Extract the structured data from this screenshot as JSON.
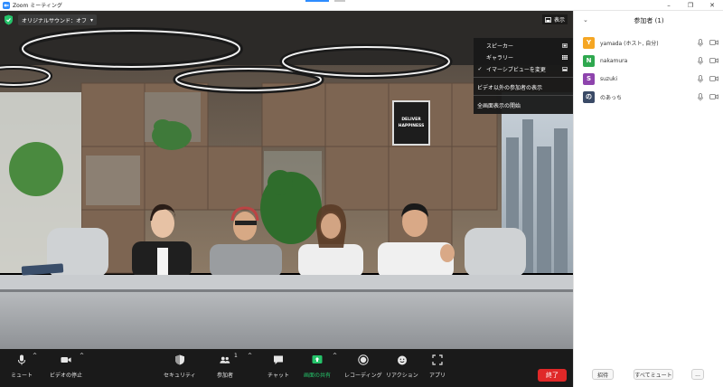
{
  "window": {
    "title": "Zoom ミーティング",
    "controls": {
      "minimize": "–",
      "restore": "❐",
      "close": "✕"
    }
  },
  "meeting": {
    "audio_label": "オリジナルサウンド：オフ",
    "audio_chevron": "▾",
    "view_button_label": "表示",
    "view_menu": {
      "items": [
        {
          "label": "スピーカー",
          "checked": false,
          "icon": "speaker-view-icon"
        },
        {
          "label": "ギャラリー",
          "checked": false,
          "icon": "gallery-view-icon"
        },
        {
          "label": "イマーシブビューを変更",
          "checked": true,
          "icon": "immersive-view-icon"
        },
        {
          "label": "ビデオ以外の参加者の表示",
          "checked": false
        },
        {
          "label": "全画面表示の開始",
          "checked": false
        }
      ],
      "check_mark": "✓"
    },
    "poster_text": [
      "DELIVER",
      "HAPPINESS"
    ]
  },
  "toolbar": {
    "items": [
      {
        "id": "mute",
        "label": "ミュート",
        "icon": "microphone-icon",
        "has_caret": true
      },
      {
        "id": "video",
        "label": "ビデオの停止",
        "icon": "video-camera-icon",
        "has_caret": true
      },
      {
        "id": "security",
        "label": "セキュリティ",
        "icon": "shield-icon",
        "has_caret": false
      },
      {
        "id": "participants",
        "label": "参加者",
        "icon": "participants-icon",
        "has_caret": true,
        "count": "1"
      },
      {
        "id": "chat",
        "label": "チャット",
        "icon": "chat-icon",
        "has_caret": false
      },
      {
        "id": "share",
        "label": "画面の共有",
        "icon": "share-screen-icon",
        "has_caret": true,
        "highlight": true
      },
      {
        "id": "record",
        "label": "レコーディング",
        "icon": "record-icon",
        "has_caret": false
      },
      {
        "id": "reactions",
        "label": "リアクション",
        "icon": "reaction-icon",
        "has_caret": false
      },
      {
        "id": "apps",
        "label": "アプリ",
        "icon": "apps-icon",
        "has_caret": false
      }
    ],
    "caret": "^",
    "end_label": "終了"
  },
  "participants_panel": {
    "title": "参加者 (1)",
    "collapse_icon": "chevron-down-icon",
    "collapse_glyph": "⌄",
    "participants": [
      {
        "initial": "Y",
        "name": "yamada (ホスト, 自分)",
        "color": "#f5a623"
      },
      {
        "initial": "N",
        "name": "nakamura",
        "color": "#2fa84f"
      },
      {
        "initial": "S",
        "name": "suzuki",
        "color": "#8e44ad"
      },
      {
        "initial": "の",
        "name": "のあっち",
        "color": "#3a4a66"
      }
    ],
    "buttons": {
      "invite": "招待",
      "mute_all": "すべてミュート",
      "more": "..."
    }
  },
  "colors": {
    "zoom_blue": "#2d8cff",
    "end_red": "#e02828",
    "share_green": "#25c36a",
    "toolbar_bg": "#1a1a1a"
  }
}
